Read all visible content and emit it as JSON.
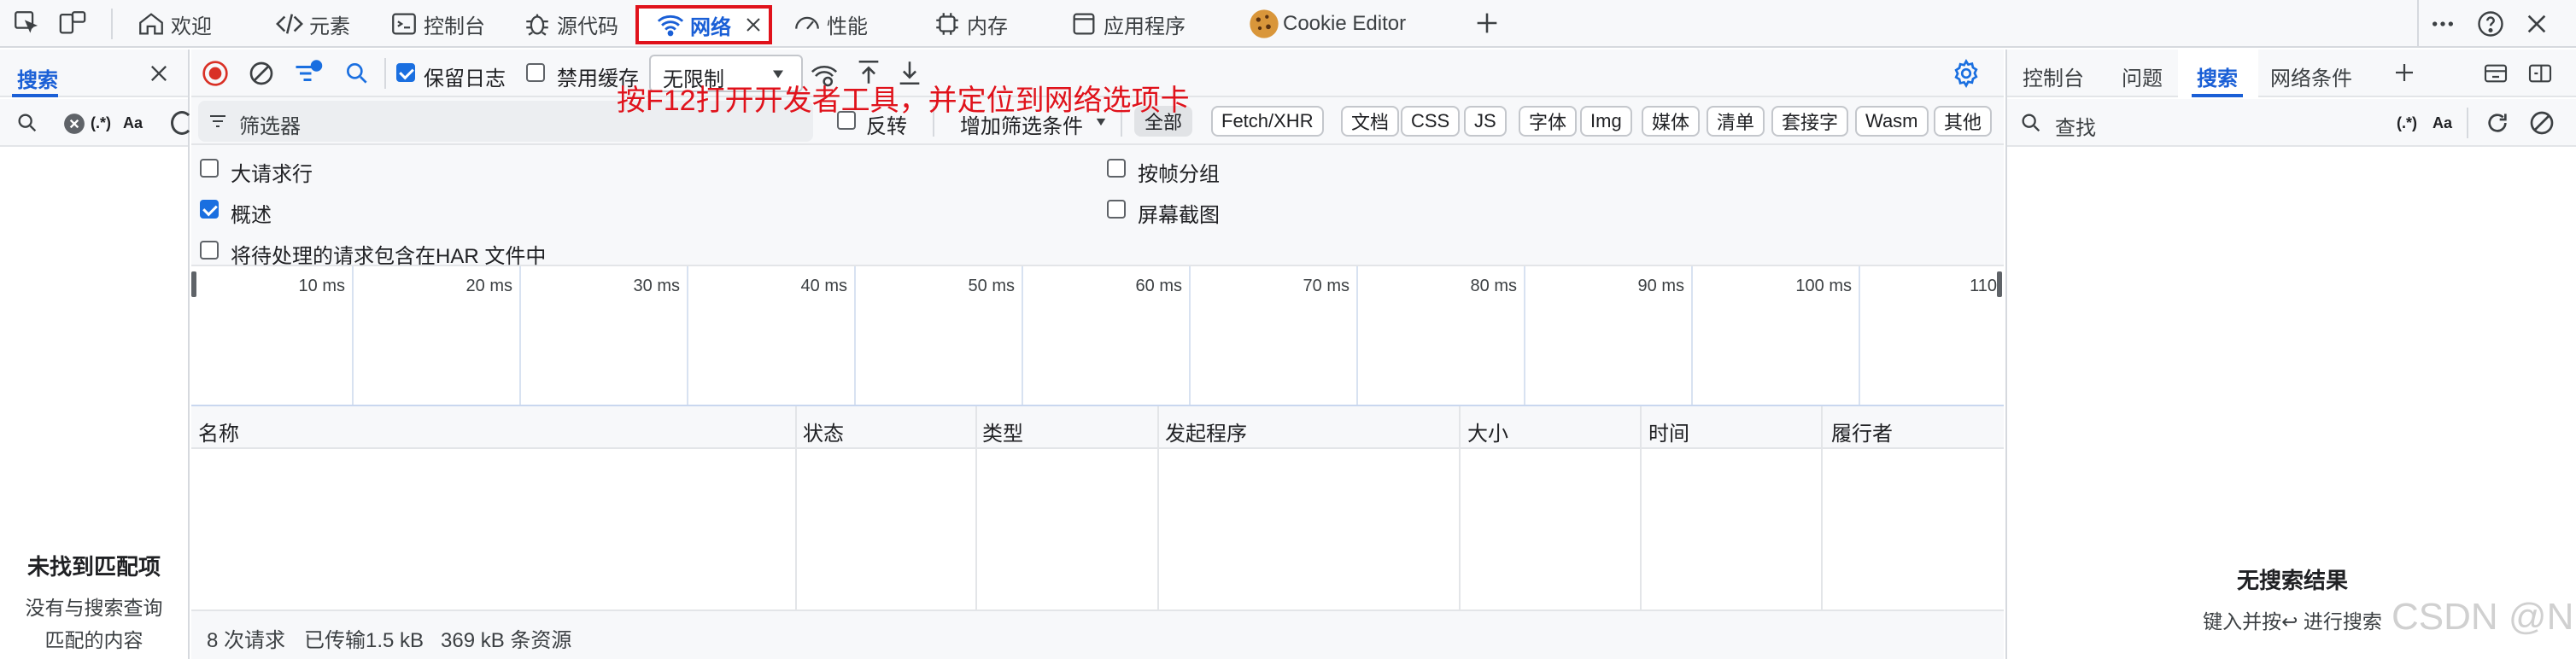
{
  "top_tabs": {
    "welcome": "欢迎",
    "elements": "元素",
    "console": "控制台",
    "sources": "源代码",
    "network": "网络",
    "performance": "性能",
    "memory": "内存",
    "application": "应用程序",
    "cookie_editor": "Cookie Editor"
  },
  "left_panel": {
    "tab": "搜索",
    "regex": "(.*)",
    "case": "Aa",
    "empty_title": "未找到匹配项",
    "empty_desc_1": "没有与搜索查询",
    "empty_desc_2": "匹配的内容"
  },
  "toolbar": {
    "preserve_log": "保留日志",
    "preserve_log_checked": true,
    "disable_cache": "禁用缓存",
    "disable_cache_checked": false,
    "throttling": "无限制"
  },
  "filter_bar": {
    "placeholder": "筛选器",
    "invert": "反转",
    "more_filters": "增加筛选条件",
    "types": [
      "全部",
      "Fetch/XHR",
      "文档",
      "CSS",
      "JS",
      "字体",
      "Img",
      "媒体",
      "清单",
      "套接字",
      "Wasm",
      "其他"
    ],
    "active_type": "全部"
  },
  "options": {
    "big_request_rows": "大请求行",
    "big_request_rows_checked": false,
    "overview": "概述",
    "overview_checked": true,
    "har_pending": "将待处理的请求包含在HAR 文件中",
    "har_pending_checked": false,
    "group_by_frame": "按帧分组",
    "group_by_frame_checked": false,
    "screenshots": "屏幕截图",
    "screenshots_checked": false
  },
  "timeline": {
    "ticks": [
      "10 ms",
      "20 ms",
      "30 ms",
      "40 ms",
      "50 ms",
      "60 ms",
      "70 ms",
      "80 ms",
      "90 ms",
      "100 ms",
      "110"
    ]
  },
  "table": {
    "columns": [
      "名称",
      "状态",
      "类型",
      "发起程序",
      "大小",
      "时间",
      "履行者"
    ]
  },
  "status": {
    "requests": "8 次请求",
    "transferred": "已传输1.5 kB",
    "resources": "369 kB 条资源"
  },
  "right_panel": {
    "tabs": [
      "控制台",
      "问题",
      "搜索",
      "网络条件"
    ],
    "active_tab": "搜索",
    "search_placeholder": "查找",
    "regex": "(.*)",
    "case": "Aa",
    "empty_title": "无搜索结果",
    "empty_hint": "键入并按↩ 进行搜索"
  },
  "annotation": "按F12打开开发者工具，并定位到网络选项卡",
  "watermark": "CSDN @NPE~",
  "colors": {
    "accent": "#1a6fe0",
    "highlight_border": "#e0121b",
    "record": "#d93025"
  }
}
